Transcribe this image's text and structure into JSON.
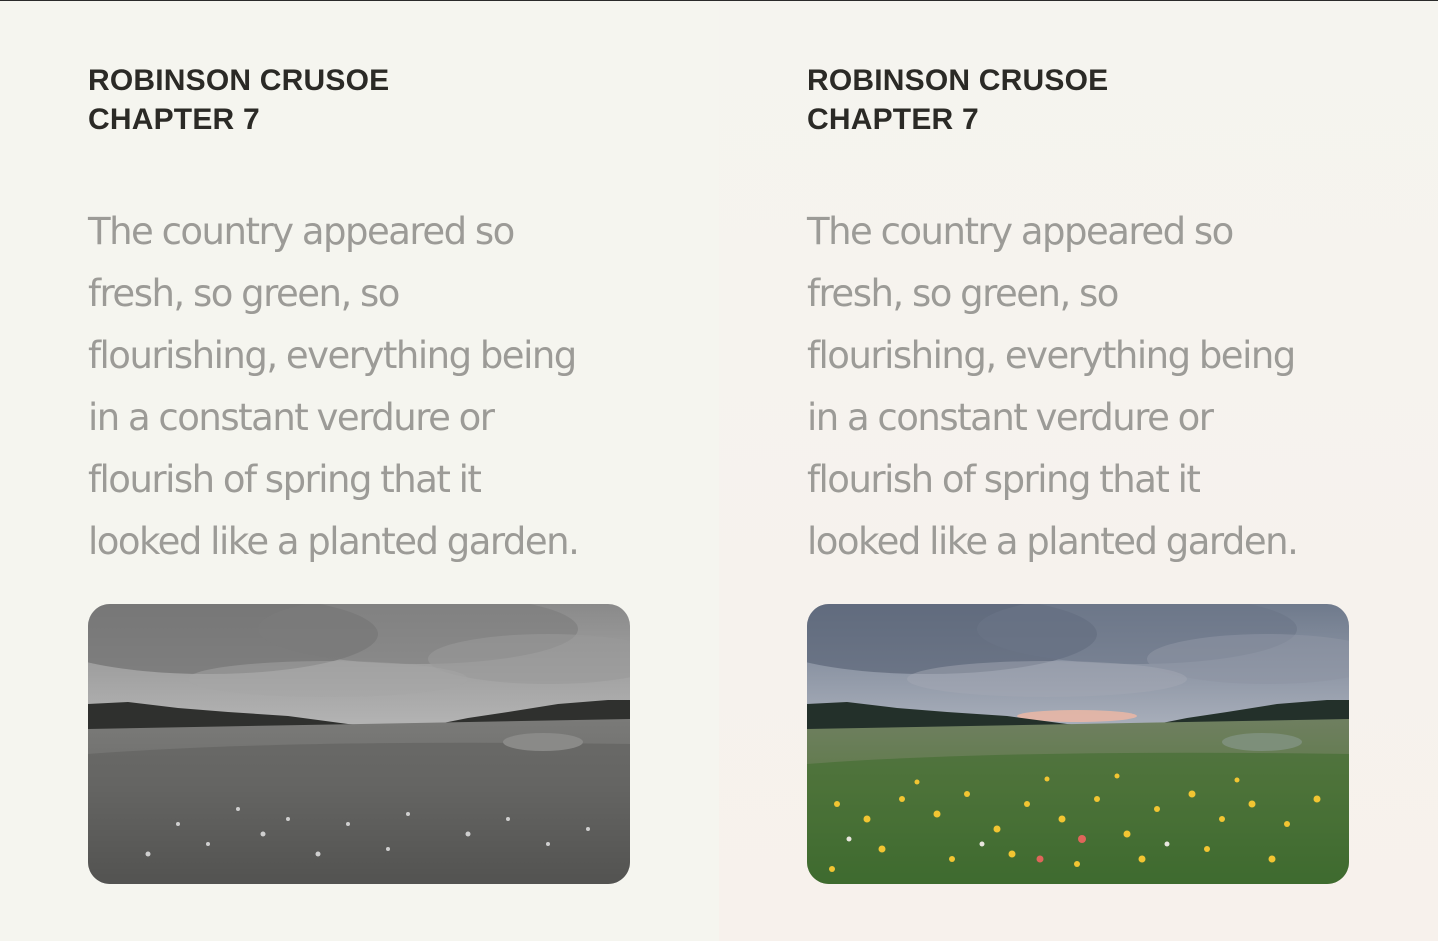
{
  "panels": [
    {
      "variant": "grayscale",
      "header": {
        "line1": "ROBINSON CRUSOE",
        "line2": "CHAPTER 7"
      },
      "lines": [
        "The country appeared so",
        "fresh, so green, so",
        "flourishing, everything being",
        "in a constant verdure or",
        "flourish of spring that it",
        "looked like a planted garden."
      ]
    },
    {
      "variant": "color",
      "header": {
        "line1": "ROBINSON CRUSOE",
        "line2": "CHAPTER 7"
      },
      "lines": [
        "The country appeared so",
        "fresh, so green, so",
        "flourishing, everything being",
        "in a constant verdure or",
        "flourish of spring that it",
        "looked like a planted garden."
      ]
    }
  ],
  "colors": {
    "header_text": "#2b2a26",
    "body_text": "#9c9b97",
    "background": "#f5f4ef"
  }
}
